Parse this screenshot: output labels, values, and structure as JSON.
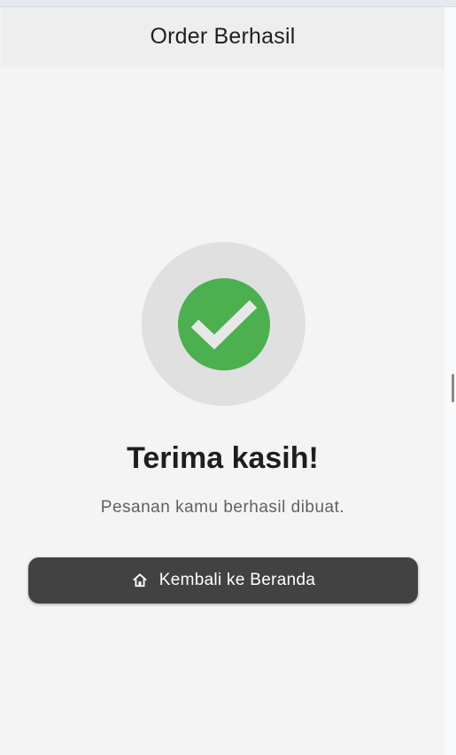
{
  "appbar": {
    "title": "Order Berhasil"
  },
  "status": {
    "icon": "check-circle-icon",
    "accent": "#4caf50",
    "ring": "#e0e0e0"
  },
  "message": {
    "heading": "Terima kasih!",
    "subtext": "Pesanan kamu berhasil dibuat."
  },
  "button": {
    "label": "Kembali ke Beranda",
    "icon": "home-icon",
    "color": "#424242"
  }
}
